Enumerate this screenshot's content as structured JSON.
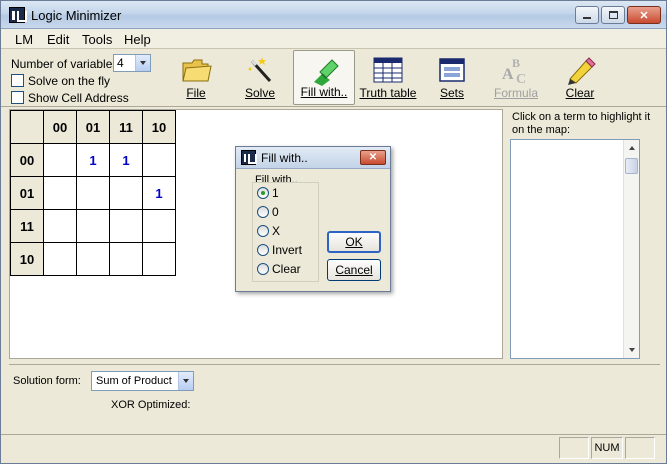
{
  "window": {
    "title": "Logic Minimizer"
  },
  "menu": [
    "LM",
    "Edit",
    "Tools",
    "Help"
  ],
  "toolbar": {
    "num_vars_label": "Number of variables:",
    "num_vars_value": "4",
    "solve_on_fly_label": "Solve on the fly",
    "show_cell_address_label": "Show Cell Address",
    "tools": [
      {
        "label": "File"
      },
      {
        "label": "Solve"
      },
      {
        "label": "Fill with.."
      },
      {
        "label": "Truth table"
      },
      {
        "label": "Sets"
      },
      {
        "label": "Formula"
      },
      {
        "label": "Clear"
      }
    ]
  },
  "kmap": {
    "col_headers": [
      "00",
      "01",
      "11",
      "10"
    ],
    "row_headers": [
      "00",
      "01",
      "11",
      "10"
    ],
    "cells": [
      [
        "",
        "1",
        "1",
        ""
      ],
      [
        "",
        "",
        "",
        "1"
      ],
      [
        "",
        "",
        "",
        ""
      ],
      [
        "",
        "",
        "",
        ""
      ]
    ]
  },
  "term_panel": {
    "label": "Click on a term to highlight it on the map:"
  },
  "bottom": {
    "solution_form_label": "Solution form:",
    "solution_form_value": "Sum of Product",
    "xor_label": "XOR Optimized:"
  },
  "status": {
    "num": "NUM"
  },
  "dialog": {
    "title": "Fill with..",
    "group_label": "Fill with..",
    "options": [
      "1",
      "0",
      "X",
      "Invert",
      "Clear"
    ],
    "selected": "1",
    "ok": "OK",
    "cancel": "Cancel"
  }
}
